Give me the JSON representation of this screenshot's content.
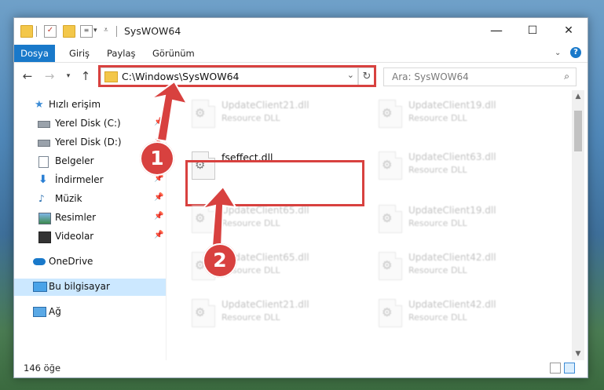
{
  "window": {
    "title": "SysWOW64",
    "controls": {
      "minimize": "—",
      "maximize": "☐",
      "close": "✕"
    }
  },
  "ribbon": {
    "tabs": [
      "Dosya",
      "Giriş",
      "Paylaş",
      "Görünüm"
    ]
  },
  "nav": {
    "address": "C:\\Windows\\SysWOW64",
    "search_placeholder": "Ara: SysWOW64"
  },
  "sidebar": {
    "items": [
      {
        "label": "Hızlı erişim",
        "icon": "star-icon"
      },
      {
        "label": "Yerel Disk (C:)",
        "icon": "drive-icon",
        "pinned": true
      },
      {
        "label": "Yerel Disk (D:)",
        "icon": "drive-icon",
        "pinned": true
      },
      {
        "label": "Belgeler",
        "icon": "documents-icon",
        "pinned": true
      },
      {
        "label": "İndirmeler",
        "icon": "download-icon",
        "pinned": true
      },
      {
        "label": "Müzik",
        "icon": "music-icon",
        "pinned": true
      },
      {
        "label": "Resimler",
        "icon": "pictures-icon",
        "pinned": true
      },
      {
        "label": "Videolar",
        "icon": "videos-icon",
        "pinned": true
      },
      {
        "label": "OneDrive",
        "icon": "cloud-icon"
      },
      {
        "label": "Bu bilgisayar",
        "icon": "computer-icon",
        "selected": true
      },
      {
        "label": "Ağ",
        "icon": "network-icon"
      }
    ]
  },
  "files": {
    "left": [
      {
        "name": "UpdateClient21.dll",
        "type": "Resource DLL"
      },
      {
        "name": "fseffect.dll",
        "type": ""
      },
      {
        "name": "UpdateClient65.dll",
        "type": "Resource DLL"
      },
      {
        "name": "UpdateClient65.dll",
        "type": "Resource DLL"
      },
      {
        "name": "UpdateClient21.dll",
        "type": "Resource DLL"
      }
    ],
    "right": [
      {
        "name": "UpdateClient19.dll",
        "type": "Resource DLL"
      },
      {
        "name": "UpdateClient63.dll",
        "type": "Resource DLL"
      },
      {
        "name": "UpdateClient19.dll",
        "type": "Resource DLL"
      },
      {
        "name": "UpdateClient42.dll",
        "type": "Resource DLL"
      },
      {
        "name": "UpdateClient42.dll",
        "type": "Resource DLL"
      }
    ]
  },
  "status": {
    "count": "146 öğe"
  },
  "callouts": [
    "1",
    "2"
  ],
  "colors": {
    "accent": "#1979ca",
    "highlight": "#d8413f",
    "selection": "#cce8ff"
  }
}
